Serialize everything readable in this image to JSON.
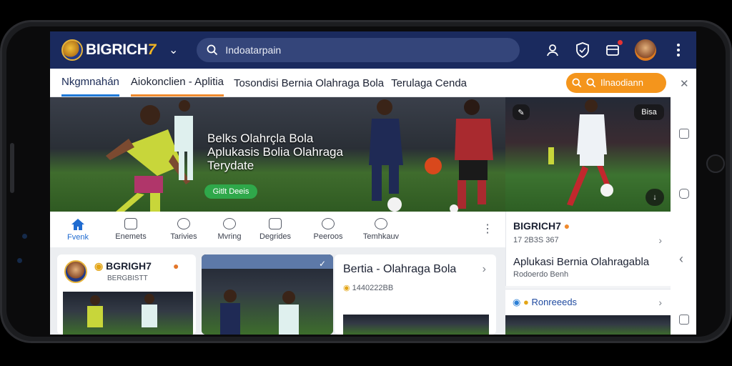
{
  "app": {
    "brand": "BIGRICH",
    "brand_suffix": "7"
  },
  "search": {
    "placeholder": "Indoatarpain"
  },
  "tabs": [
    {
      "label": "Nkgmnahán"
    },
    {
      "label": "Aiokonclien - Aplitia"
    },
    {
      "label": "Tosondisi Bernia Olahraga Bola"
    },
    {
      "label": "Terulaga Cenda"
    }
  ],
  "action_button": {
    "label": "Ilnaodiann"
  },
  "hero": {
    "headline_1": "Belks Olahrçla Bola",
    "headline_2": "Aplukasis Bolia Olahraga",
    "headline_3": "Terydate",
    "cta": "Gitlt Deeis"
  },
  "hero_side": {
    "chip": "Bisa"
  },
  "nav": [
    {
      "label": "Fvenk",
      "icon": "home-icon"
    },
    {
      "label": "Enemets",
      "icon": "calendar-icon"
    },
    {
      "label": "Tarivies",
      "icon": "user-circle-icon"
    },
    {
      "label": "Mvring",
      "icon": "ticket-icon"
    },
    {
      "label": "Degrides",
      "icon": "chat-icon"
    },
    {
      "label": "Peeroos",
      "icon": "trophy-icon"
    },
    {
      "label": "Temhkauv",
      "icon": "info-icon"
    }
  ],
  "info_card": {
    "title": "BIGRICH7",
    "sub": "17 2B3S 367",
    "body_title": "Aplukasi Bernia Olahragabla",
    "body_sub": "Rodoerdo Benh"
  },
  "feed": {
    "card1_name": "BGRIGH7",
    "card1_sub": "BERGBISTT",
    "card3_title": "Bertia - Olahraga Bola",
    "card3_sub": "1440222BB"
  },
  "side_list": {
    "label": "Ronreeeds"
  },
  "colors": {
    "topbar": "#1a2a5e",
    "accent": "#1f7ad8",
    "orange": "#f4951c",
    "green": "#2fa84a"
  }
}
